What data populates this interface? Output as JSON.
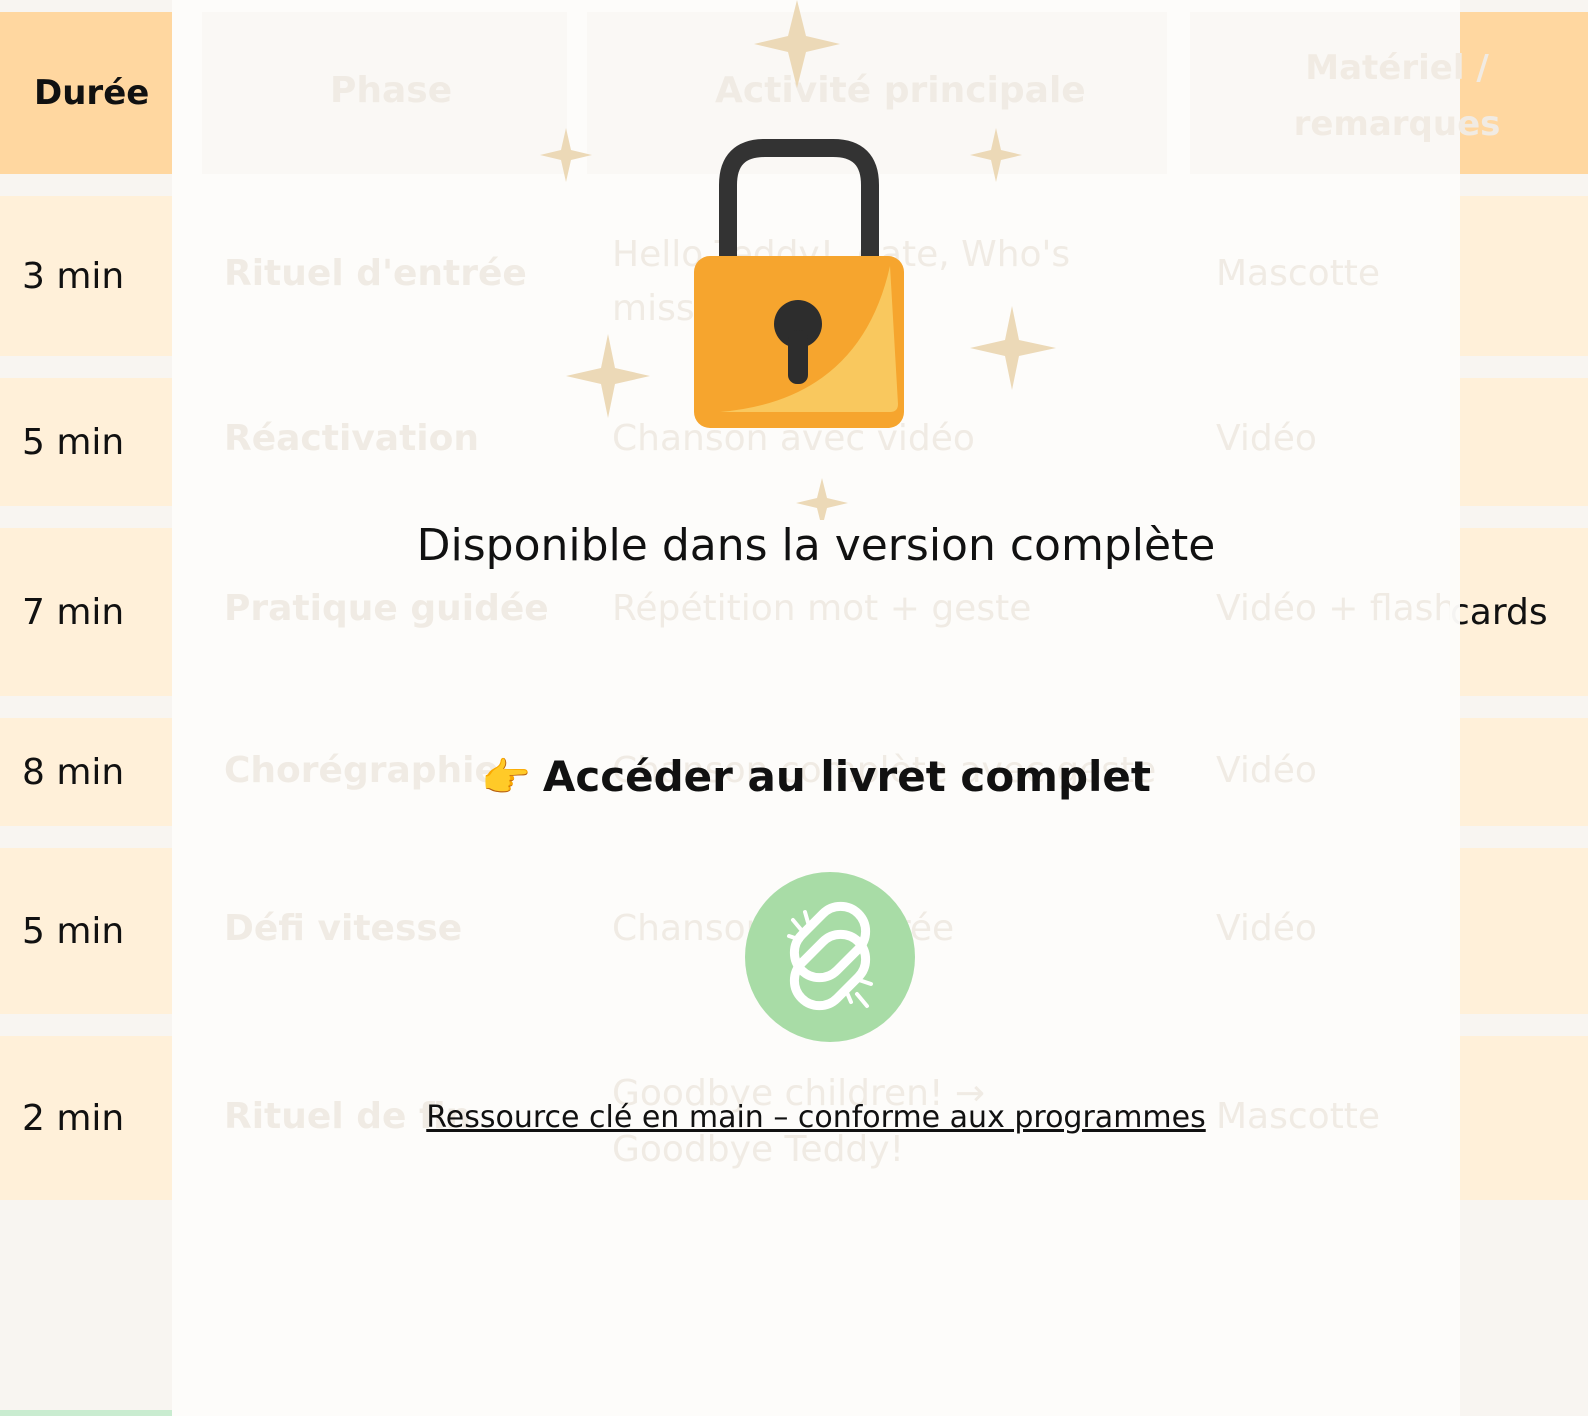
{
  "table": {
    "headers": {
      "duree": "Durée",
      "phase": "Phase",
      "activite": "Activité principale",
      "materiel_line1": "Matériel /",
      "materiel_line2": "remarques"
    },
    "rows": [
      {
        "duree": "3 min",
        "phase": "Rituel d'entrée",
        "activite": "Hello Teddy!, date, Who's missing?",
        "materiel": "Mascotte"
      },
      {
        "duree": "5 min",
        "phase": "Réactivation",
        "activite": "Chanson avec vidéo",
        "materiel": "Vidéo"
      },
      {
        "duree": "7 min",
        "phase": "Pratique guidée",
        "activite": "Répétition mot + geste",
        "materiel": "Vidéo + flashcards"
      },
      {
        "duree": "8 min",
        "phase": "Chorégraphie",
        "activite": "Chanson complète avec geste",
        "materiel": "Vidéo"
      },
      {
        "duree": "5 min",
        "phase": "Défi vitesse",
        "activite": "Chanson accélérée",
        "materiel": "Vidéo"
      },
      {
        "duree": "2 min",
        "phase": "Rituel de fin",
        "activite": "Goodbye children! → Goodbye Teddy!",
        "materiel": "Mascotte"
      }
    ],
    "visible_right": {
      "row3": "cards"
    }
  },
  "overlay": {
    "title": "Disponible dans la version complète",
    "cta_emoji": "👉",
    "cta_label": "Accéder au livret complet",
    "footer_link": "Ressource clé en main – conforme aux programmes",
    "colors": {
      "lock_body": "#f6a52e",
      "lock_shackle": "#333333",
      "sparkle": "#ecd9b7",
      "link_circle": "#a8dca6"
    },
    "icons": [
      "lock-icon",
      "sparkle-icon",
      "broken-link-icon",
      "pointing-hand-emoji"
    ]
  }
}
